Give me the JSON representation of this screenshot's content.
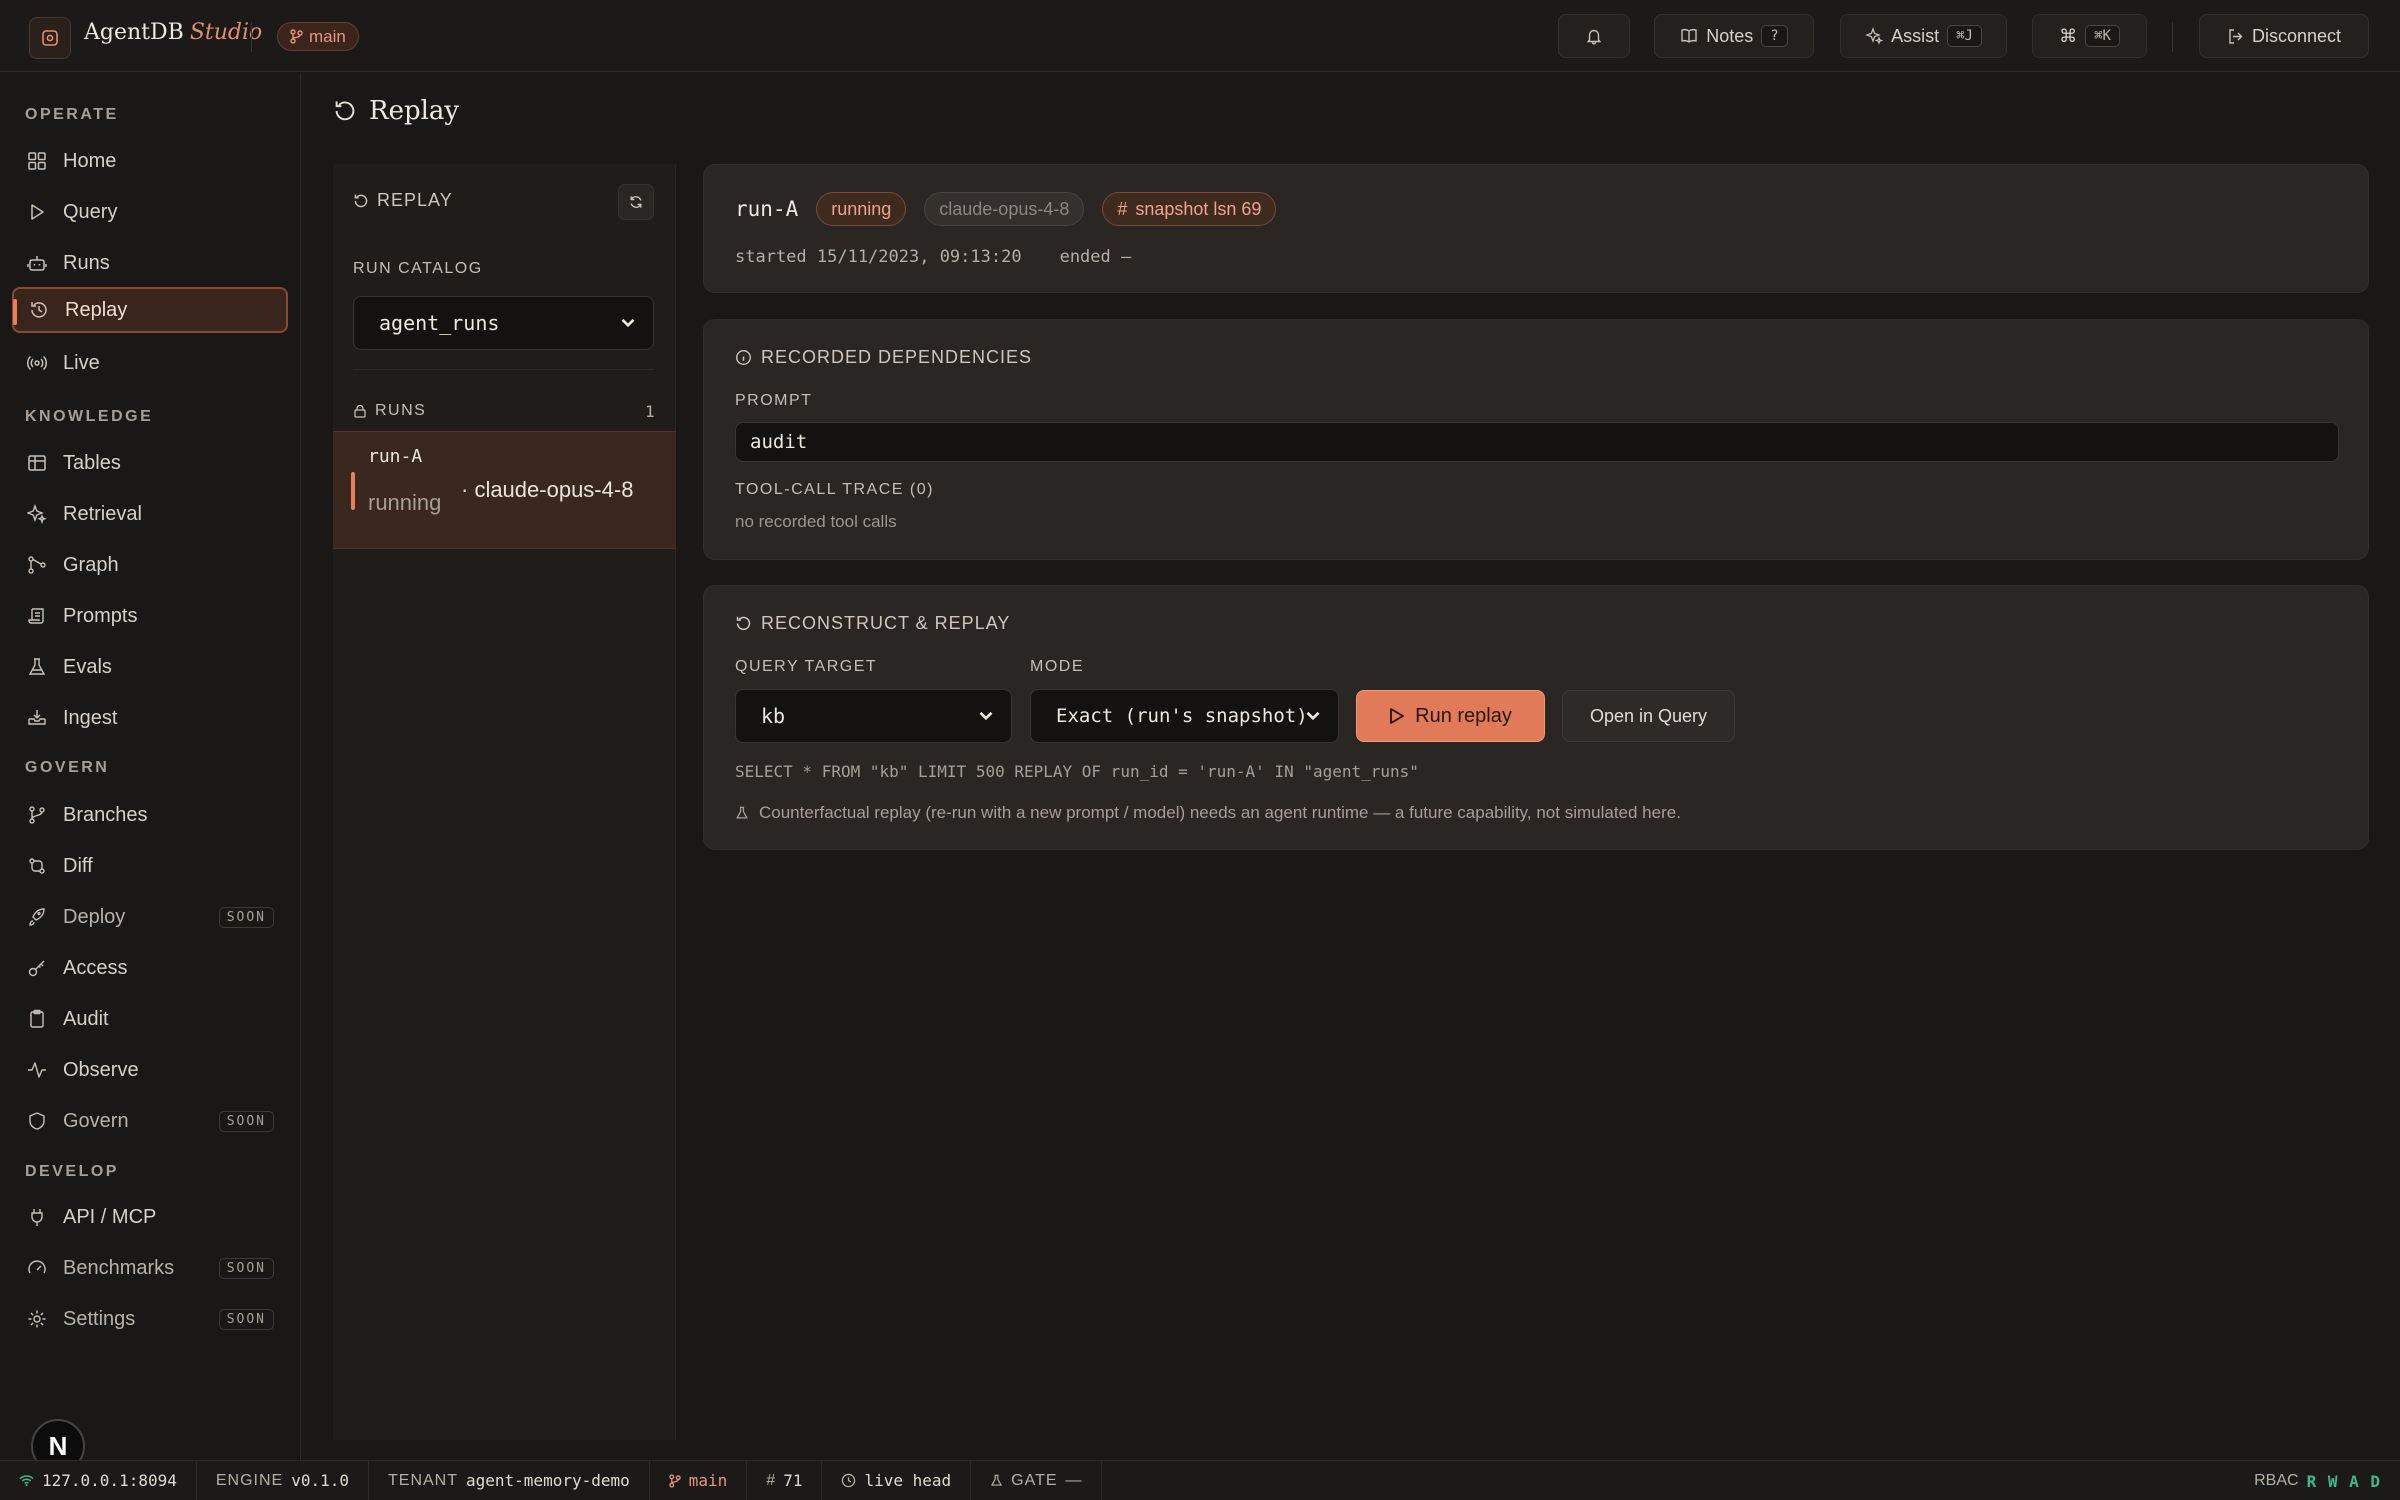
{
  "app": {
    "name": "AgentDB",
    "suffix": "Studio",
    "branch": "main"
  },
  "topbar": {
    "notes_label": "Notes",
    "notes_key": "?",
    "assist_label": "Assist",
    "assist_key": "⌘J",
    "cmd_symbol": "⌘",
    "cmd_key": "⌘K",
    "disconnect_label": "Disconnect"
  },
  "sidebar": {
    "sections": [
      "OPERATE",
      "KNOWLEDGE",
      "GOVERN",
      "DEVELOP"
    ],
    "items": [
      {
        "label": "Home",
        "icon": "grid-icon"
      },
      {
        "label": "Query",
        "icon": "play-icon"
      },
      {
        "label": "Runs",
        "icon": "bot-icon"
      },
      {
        "label": "Replay",
        "icon": "history-icon",
        "active": true
      },
      {
        "label": "Live",
        "icon": "broadcast-icon"
      },
      {
        "label": "Tables",
        "icon": "table-icon"
      },
      {
        "label": "Retrieval",
        "icon": "sparkle-icon"
      },
      {
        "label": "Graph",
        "icon": "graph-icon"
      },
      {
        "label": "Prompts",
        "icon": "scroll-icon"
      },
      {
        "label": "Evals",
        "icon": "flask-icon"
      },
      {
        "label": "Ingest",
        "icon": "inbox-icon"
      },
      {
        "label": "Branches",
        "icon": "branch-icon"
      },
      {
        "label": "Diff",
        "icon": "diff-icon"
      },
      {
        "label": "Deploy",
        "icon": "rocket-icon",
        "badge": "SOON"
      },
      {
        "label": "Access",
        "icon": "key-icon"
      },
      {
        "label": "Audit",
        "icon": "clipboard-icon"
      },
      {
        "label": "Observe",
        "icon": "activity-icon"
      },
      {
        "label": "Govern",
        "icon": "shield-icon",
        "badge": "SOON"
      },
      {
        "label": "API / MCP",
        "icon": "plug-icon"
      },
      {
        "label": "Benchmarks",
        "icon": "gauge-icon",
        "badge": "SOON"
      },
      {
        "label": "Settings",
        "icon": "gear-icon",
        "badge": "SOON"
      }
    ],
    "avatar": "N"
  },
  "page": {
    "title": "Replay"
  },
  "catalog_panel": {
    "header": "REPLAY",
    "catalog_label": "RUN CATALOG",
    "catalog_value": "agent_runs",
    "runs_label": "RUNS",
    "runs_count": "1",
    "run": {
      "id": "run-A",
      "status": "running",
      "model": "· claude-opus-4-8"
    }
  },
  "run_card": {
    "id": "run-A",
    "status": "running",
    "model": "claude-opus-4-8",
    "snapshot": "snapshot lsn 69",
    "started": "started 15/11/2023, 09:13:20",
    "ended": "ended —"
  },
  "deps_card": {
    "title": "RECORDED DEPENDENCIES",
    "prompt_label": "PROMPT",
    "prompt_value": "audit",
    "trace_label": "TOOL-CALL TRACE (0)",
    "trace_empty": "no recorded tool calls"
  },
  "replay_card": {
    "title": "RECONSTRUCT & REPLAY",
    "target_label": "QUERY TARGET",
    "target_value": "kb",
    "mode_label": "MODE",
    "mode_value": "Exact (run's snapshot)",
    "run_button": "Run replay",
    "open_button": "Open in Query",
    "sql": "SELECT * FROM \"kb\" LIMIT 500 REPLAY OF run_id = 'run-A' IN \"agent_runs\"",
    "note": "Counterfactual replay (re-run with a new prompt / model) needs an agent runtime — a future capability, not simulated here."
  },
  "statusbar": {
    "host": "127.0.0.1:8094",
    "engine_label": "ENGINE",
    "engine_value": "v0.1.0",
    "tenant_label": "TENANT",
    "tenant_value": "agent-memory-demo",
    "branch": "main",
    "lsn": "71",
    "head": "live head",
    "gate_label": "GATE",
    "gate_value": "—",
    "rbac_label": "RBAC",
    "rbac_value": "R W A D"
  },
  "colors": {
    "accent": "#e07a58",
    "bg": "#1a1816",
    "card": "#2a2623",
    "ok": "#3cb88a"
  }
}
